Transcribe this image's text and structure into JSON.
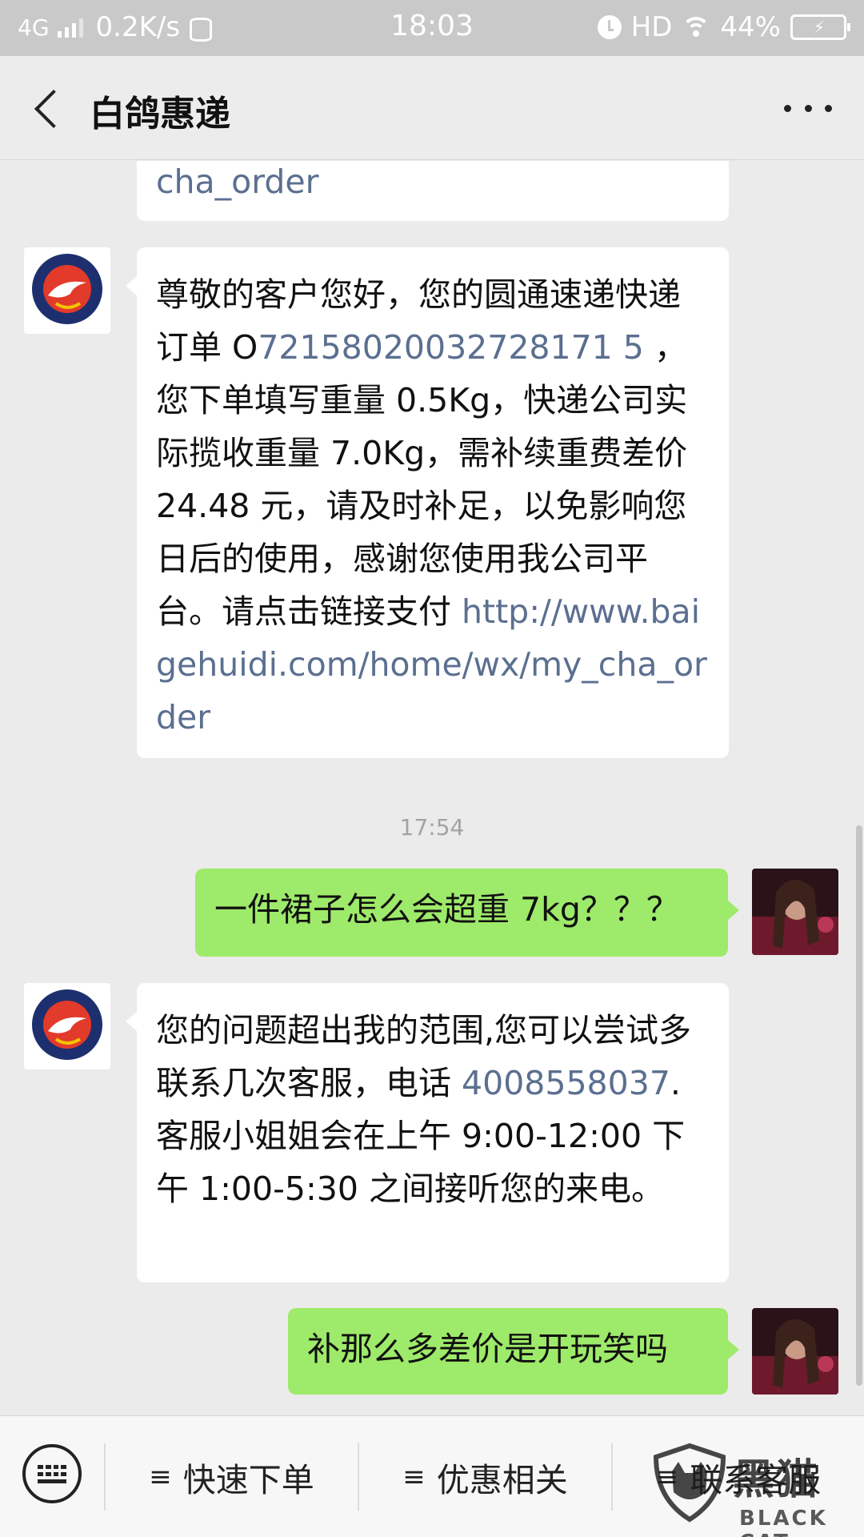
{
  "status_bar": {
    "network": "4G",
    "speed": "0.2K/s",
    "time": "18:03",
    "hd": "HD",
    "battery": "44%"
  },
  "header": {
    "title": "白鸽惠递"
  },
  "messages": [
    {
      "from": "bot",
      "text_parts": [
        {
          "text": "cha_order",
          "type": "link"
        }
      ]
    },
    {
      "from": "bot",
      "text_parts": [
        {
          "text": "尊敬的客户您好，您的圆通速递快递订单 O",
          "type": "text"
        },
        {
          "text": "72158020032728171 5",
          "type": "link"
        },
        {
          "text": " ，您下单填写重量 0.5Kg，快递公司实际揽收重量 7.0Kg，需补续重费差价 24.48 元，请及时补足，以免影响您日后的使用，感谢您使用我公司平台。请点击链接支付 ",
          "type": "text"
        },
        {
          "text": "http://www.baigehuidi.com/home/wx/my_cha_order",
          "type": "link"
        }
      ]
    },
    {
      "from": "time",
      "text": "17:54"
    },
    {
      "from": "me",
      "text": "一件裙子怎么会超重 7kg？？？"
    },
    {
      "from": "bot",
      "text_parts": [
        {
          "text": "您的问题超出我的范围,您可以尝试多联系几次客服，电话 ",
          "type": "text"
        },
        {
          "text": "4008558037",
          "type": "link"
        },
        {
          "text": ".客服小姐姐会在上午 9:00-12:00  下午 1:00-5:30 之间接听您的来电。",
          "type": "text"
        }
      ]
    },
    {
      "from": "me",
      "text": "补那么多差价是开玩笑吗"
    }
  ],
  "menu": {
    "items": [
      "快速下单",
      "优惠相关",
      "联系客服"
    ]
  },
  "watermark": {
    "cn": "黑猫",
    "en": "BLACK CAT"
  },
  "colors": {
    "link": "#5b6f90",
    "my_bubble": "#9eea6a",
    "background": "#ebebeb"
  }
}
